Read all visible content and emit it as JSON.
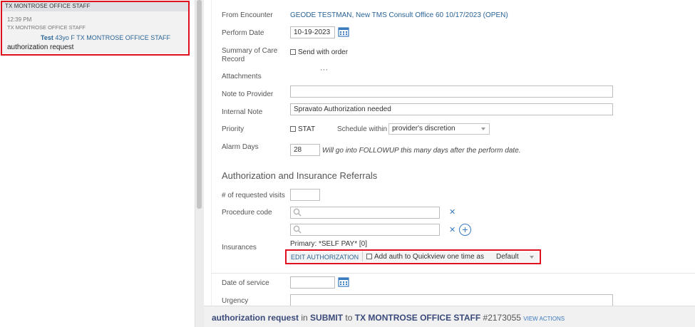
{
  "left": {
    "header": "TX MONTROSE OFFICE STAFF",
    "card": {
      "time": "12:39 PM",
      "dept": "TX MONTROSE OFFICE STAFF",
      "patient_name": "Test",
      "patient_info": "43yo F TX MONTROSE OFFICE STAFF",
      "subject": "authorization request"
    }
  },
  "form": {
    "from_encounter_label": "From Encounter",
    "from_encounter_value": "GEODE TESTMAN, New TMS Consult Office 60 10/17/2023 (OPEN)",
    "perform_date_label": "Perform Date",
    "perform_date_value": "10-19-2023",
    "summary_label_1": "Summary of Care",
    "summary_label_2": "Record",
    "send_with_order": "Send with order",
    "attachments_label": "Attachments",
    "attachments_more": "···",
    "note_to_provider_label": "Note to Provider",
    "note_to_provider_value": "",
    "internal_note_label": "Internal Note",
    "internal_note_value": "Spravato Authorization needed",
    "priority_label": "Priority",
    "stat_label": "STAT",
    "schedule_within_label": "Schedule within",
    "schedule_within_value": "provider's discretion",
    "alarm_days_label": "Alarm Days",
    "alarm_days_value": "28",
    "alarm_days_hint": "Will go into FOLLOWUP this many days after the perform date."
  },
  "auth": {
    "section_title": "Authorization and Insurance Referrals",
    "requested_visits_label": "# of requested visits",
    "procedure_code_label": "Procedure code",
    "insurances_label": "Insurances",
    "primary_insurance": "Primary: *SELF PAY* [0]",
    "edit_authorization": "EDIT AUTHORIZATION",
    "add_auth_label": "Add auth to Quickview one time as",
    "add_auth_select": "Default",
    "date_of_service_label": "Date of service",
    "urgency_label": "Urgency"
  },
  "footer": {
    "subject": "authorization request",
    "in": "in",
    "status": "SUBMIT",
    "to": "to",
    "recipient": "TX MONTROSE OFFICE STAFF",
    "id": "#2173055",
    "view_actions": "VIEW ACTIONS"
  },
  "colors": {
    "accent": "#2a6496",
    "highlight": "#e0101c"
  }
}
